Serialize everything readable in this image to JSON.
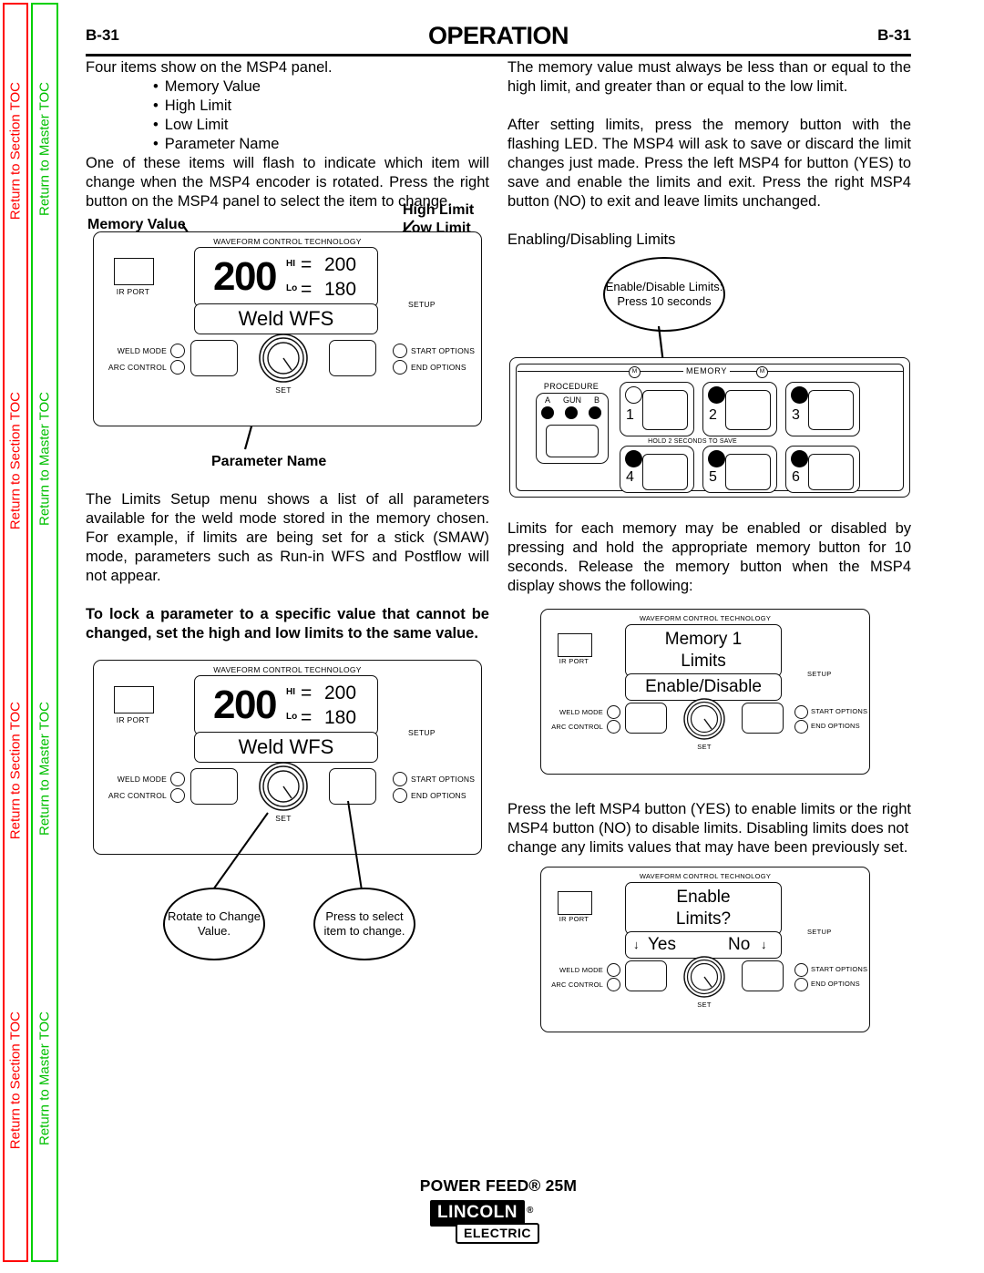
{
  "sidebar": {
    "section_toc_label": "Return to Section TOC",
    "master_toc_label": "Return to Master TOC",
    "section_color": "#ff0000",
    "master_color": "#00c000"
  },
  "header": {
    "page_left": "B-31",
    "title": "OPERATION",
    "page_right": "B-31"
  },
  "left_column": {
    "intro": "Four items show on the MSP4 panel.",
    "bullets": [
      "Memory Value",
      "High Limit",
      "Low Limit",
      "Parameter Name"
    ],
    "para_encoder": "One of these items will flash to indicate which item will change when the MSP4 encoder is rotated.   Press the right button on the MSP4 panel to select the item to change.",
    "label_memory_value": "Memory Value",
    "label_high_limit": "High Limit",
    "label_low_limit": "Low Limit",
    "label_parameter_name": "Parameter Name",
    "para_limits_menu": "The Limits Setup menu shows a list of all parameters available for the weld mode stored in the memory chosen.  For example, if limits are being set for a stick (SMAW) mode, parameters such as Run-in WFS and Postflow will not appear.",
    "para_lock_bold": "To lock a parameter to a specific value that cannot be changed, set the high and low limits to the same value.",
    "bubble_rotate": "Rotate to Change Value.",
    "bubble_press": "Press to select item to change."
  },
  "right_column": {
    "para_memory_value": "The memory value must always be less than or equal to the high limit, and greater than or equal to the low limit.",
    "para_after_setting": "After setting limits, press the memory button with the flashing LED.  The MSP4 will ask to save or discard the limit changes just made.  Press the left MSP4 for button (YES) to save and enable the limits and exit. Press the right MSP4 button (NO) to exit and leave limits unchanged.",
    "heading_enabling": "Enabling/Disabling Limits",
    "bubble_enable_disable": "Enable/Disable Limits: Press 10 seconds",
    "para_limits_each": "Limits for each memory may be enabled or disabled by pressing and hold the appropriate memory button for 10 seconds.  Release the memory button when the MSP4 display shows the following:",
    "para_press_left": "Press the left MSP4 button (YES) to enable limits or the right MSP4 button (NO) to disable limits. Disabling limits does not change any limits values that may have been previously set."
  },
  "msp4_panel": {
    "waveform_label": "WAVEFORM CONTROL TECHNOLOGY",
    "ir_port_label": "IR PORT",
    "setup_label": "SETUP",
    "weld_mode_label": "WELD MODE",
    "arc_control_label": "ARC CONTROL",
    "start_options_label": "START OPTIONS",
    "end_options_label": "END OPTIONS",
    "set_label": "SET"
  },
  "display_limits": {
    "memory_value": "200",
    "hi_label": "HI",
    "lo_label": "Lo",
    "eq": "=",
    "hi_value": "200",
    "lo_value": "180",
    "parameter_name": "Weld WFS"
  },
  "display_memory_limits": {
    "line1": "Memory  1",
    "line2": "Limits",
    "line3": "Enable/Disable"
  },
  "display_enable_limits": {
    "line1": "Enable",
    "line2": "Limits?",
    "yes": "Yes",
    "no": "No",
    "arrow": "↓"
  },
  "memory_panel": {
    "procedure_label": "PROCEDURE",
    "procedure_a": "A",
    "procedure_gun": "GUN",
    "procedure_b": "B",
    "memory_label": "MEMORY",
    "m_symbol": "M",
    "hold_label": "HOLD 2 SECONDS TO SAVE",
    "keys": [
      "1",
      "2",
      "3",
      "4",
      "5",
      "6"
    ]
  },
  "footer": {
    "product": "POWER FEED® 25M",
    "logo_primary": "LINCOLN",
    "logo_registered": "®",
    "logo_secondary": "ELECTRIC"
  }
}
